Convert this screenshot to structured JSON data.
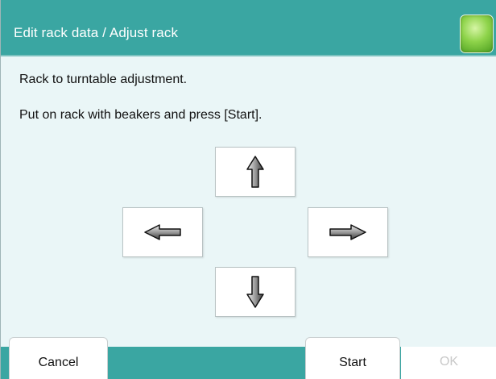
{
  "window": {
    "title": "Edit rack data / Adjust rack",
    "status_indicator": "green-status-led"
  },
  "messages": {
    "line1": "Rack to turntable adjustment.",
    "line2": "Put on rack with beakers and press [Start]."
  },
  "arrows": {
    "up": "arrow-up-icon",
    "left": "arrow-left-icon",
    "right": "arrow-right-icon",
    "down": "arrow-down-icon"
  },
  "footer": {
    "cancel_label": "Cancel",
    "start_label": "Start",
    "ok_label": "OK",
    "ok_enabled": false
  },
  "colors": {
    "title_bar": "#3aa6a2",
    "background": "#eaf6f7",
    "status_led": "#8ed34a",
    "disabled_text": "#c9c9c9"
  }
}
